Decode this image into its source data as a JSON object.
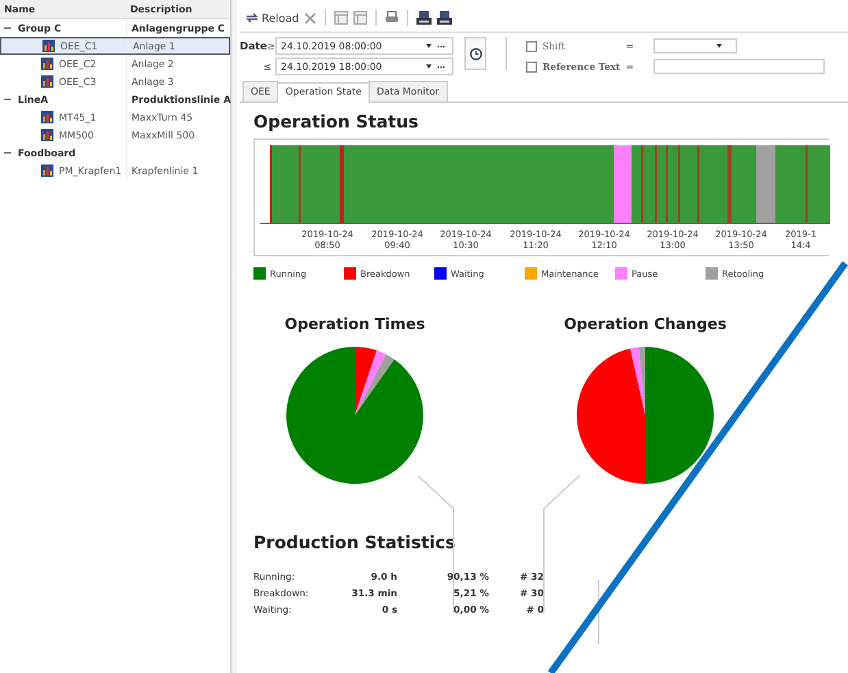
{
  "tree": {
    "columns": [
      "Name",
      "Description"
    ],
    "groups": [
      {
        "name": "Group C",
        "description": "Anlagengruppe C",
        "expanded": true,
        "children": [
          {
            "name": "OEE_C1",
            "description": "Anlage 1",
            "selected": true
          },
          {
            "name": "OEE_C2",
            "description": "Anlage 2",
            "selected": false
          },
          {
            "name": "OEE_C3",
            "description": "Anlage 3",
            "selected": false
          }
        ]
      },
      {
        "name": "LineA",
        "description": "Produktionslinie A",
        "expanded": true,
        "children": [
          {
            "name": "MT45_1",
            "description": "MaxxTurn 45",
            "selected": false
          },
          {
            "name": "MM500",
            "description": "MaxxMill 500",
            "selected": false
          }
        ]
      },
      {
        "name": "Foodboard",
        "expanded": true,
        "children": [
          {
            "name": "PM_Krapfen1",
            "description": "Krapfenlinie 1",
            "selected": false
          }
        ]
      }
    ]
  },
  "toolbar": {
    "groups": [
      [
        {
          "kind": "reload",
          "label": "Reload"
        },
        {
          "kind": "delete"
        }
      ],
      [
        {
          "kind": "sheet"
        },
        {
          "kind": "sheet"
        }
      ],
      [
        {
          "kind": "print"
        }
      ],
      [
        {
          "kind": "printer"
        },
        {
          "kind": "printer"
        }
      ]
    ]
  },
  "filter": {
    "date_label": "Date",
    "rows": [
      {
        "operator": "≥",
        "value": "24.10.2019 08:00:00"
      },
      {
        "operator": "≤",
        "value": "24.10.2019 18:00:00"
      }
    ],
    "options": [
      {
        "kind": "dropdown",
        "label": "Shift",
        "checked": false,
        "operator": "="
      },
      {
        "kind": "text",
        "label": "Reference Text",
        "checked": false,
        "operator": "="
      }
    ]
  },
  "tabs": [
    {
      "label": "OEE",
      "selected": false
    },
    {
      "label": "Operation State",
      "selected": true
    },
    {
      "label": "Data Monitor",
      "selected": false
    }
  ],
  "status": {
    "title": "Operation Status",
    "x_labels": [
      {
        "date": "2019-10-24",
        "time": "08:50"
      },
      {
        "date": "2019-10-24",
        "time": "09:40"
      },
      {
        "date": "2019-10-24",
        "time": "10:30"
      },
      {
        "date": "2019-10-24",
        "time": "11:20"
      },
      {
        "date": "2019-10-24",
        "time": "12:10"
      },
      {
        "date": "2019-10-24",
        "time": "13:00"
      },
      {
        "date": "2019-10-24",
        "time": "13:50"
      },
      {
        "date": "2019-1",
        "time": "14:4"
      }
    ],
    "legend": [
      {
        "label": "Running",
        "color": "#008000"
      },
      {
        "label": "Breakdown",
        "color": "#ff0000"
      },
      {
        "label": "Waiting",
        "color": "#0000ff"
      },
      {
        "label": "Maintenance",
        "color": "#ffa500"
      },
      {
        "label": "Pause",
        "color": "#ff80ff"
      },
      {
        "label": "Retooling",
        "color": "#a0a0a0"
      }
    ]
  },
  "pies": [
    {
      "title": "Operation Times"
    },
    {
      "title": "Operation Changes"
    }
  ],
  "stats": {
    "title": "Production Statistics",
    "rows": [
      {
        "label": "Running:",
        "duration": "9.0 h",
        "share": "90,13 %",
        "count": "# 32"
      },
      {
        "label": "Breakdown:",
        "duration": "31.3 min",
        "share": "5,21 %",
        "count": "# 30"
      },
      {
        "label": "Waiting:",
        "duration": "0 s",
        "share": "0,00 %",
        "count": "# 0"
      }
    ]
  }
}
